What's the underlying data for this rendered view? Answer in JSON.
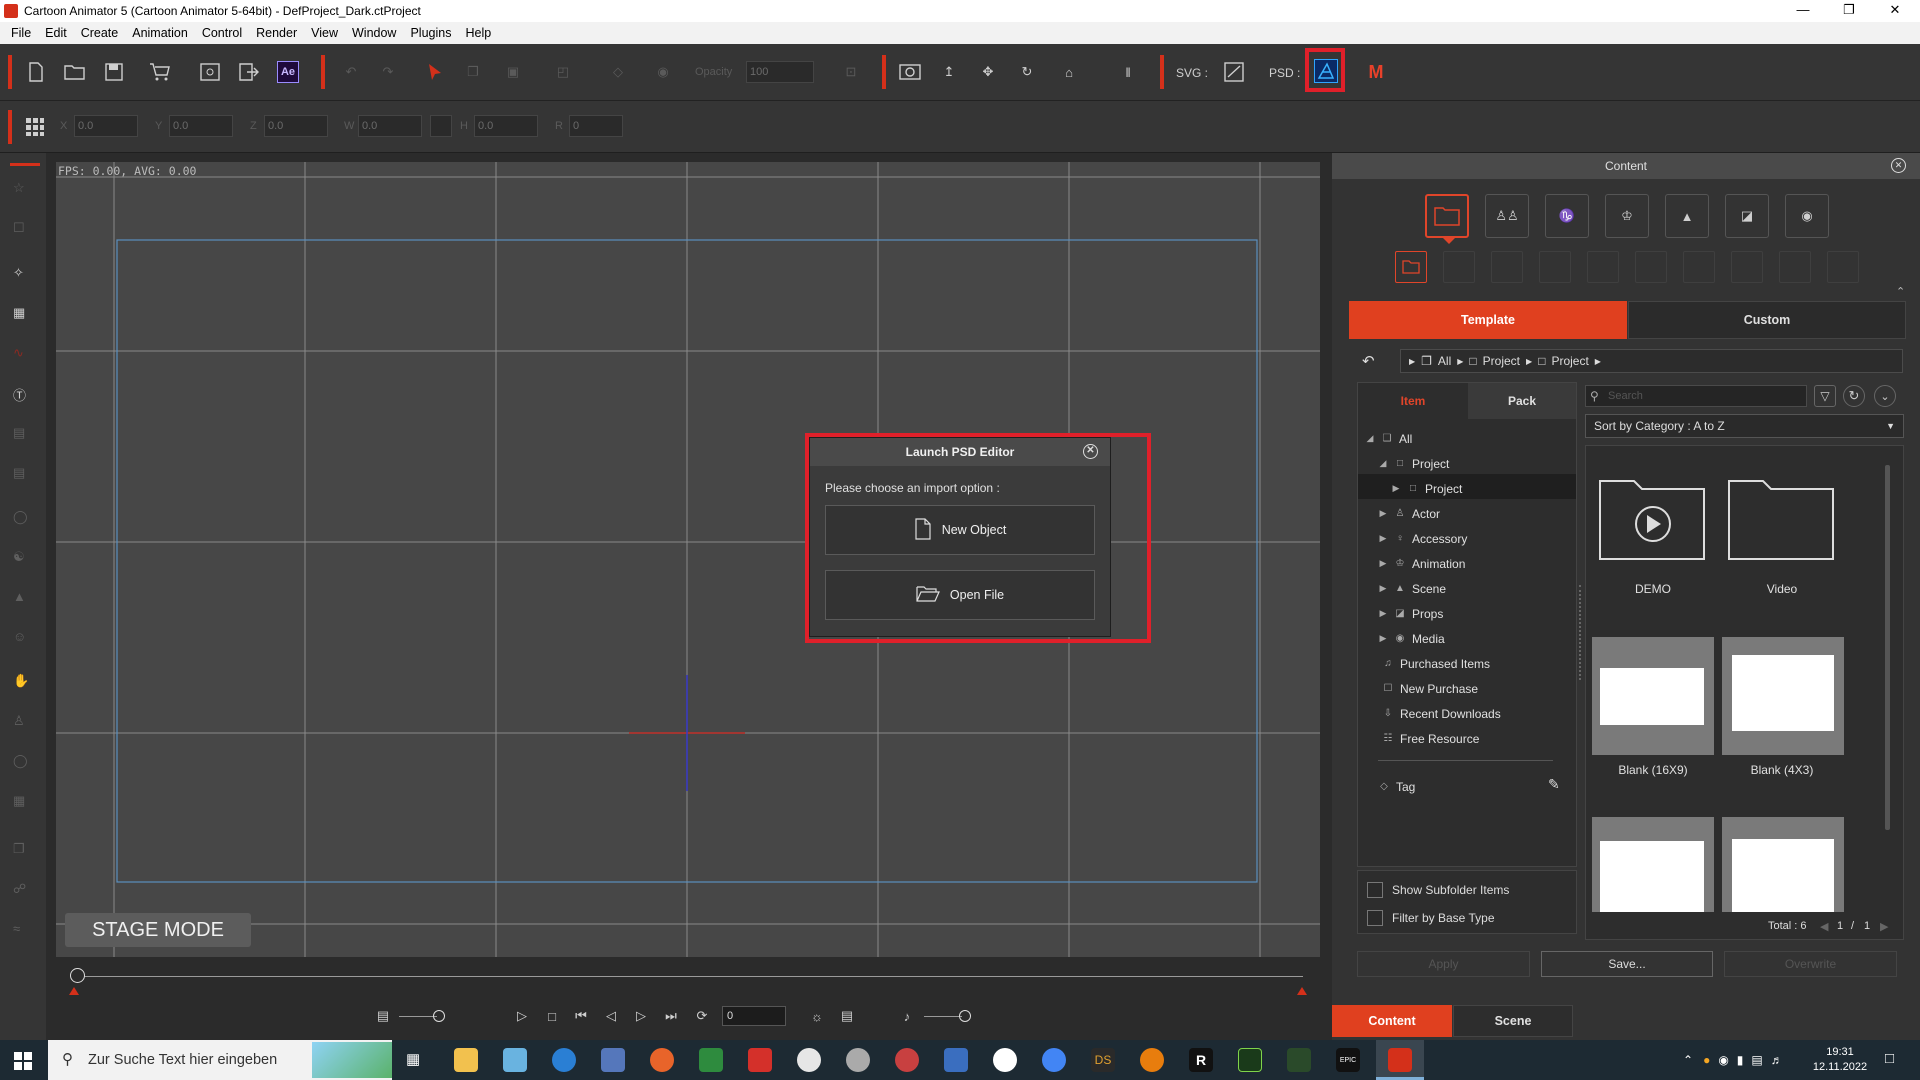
{
  "window": {
    "title": "Cartoon Animator 5  (Cartoon Animator 5-64bit) - DefProject_Dark.ctProject"
  },
  "menu": [
    "File",
    "Edit",
    "Create",
    "Animation",
    "Control",
    "Render",
    "View",
    "Window",
    "Plugins",
    "Help"
  ],
  "toolbar": {
    "ae_label": "Ae",
    "opacity_label": "Opacity",
    "opacity_value": "100",
    "svg_label": "SVG :",
    "psd_label": "PSD :"
  },
  "transform": {
    "labels": [
      "X",
      "Y",
      "Z",
      "W",
      "H",
      "R"
    ],
    "x": "0.0",
    "y": "0.0",
    "z": "0.0",
    "w": "0.0",
    "h": "0.0",
    "r": "0"
  },
  "stage": {
    "fps_text": "FPS: 0.00, AVG: 0.00",
    "mode_label": "STAGE MODE"
  },
  "dialog": {
    "title": "Launch PSD Editor",
    "prompt": "Please choose an import option :",
    "new_object_label": "New Object",
    "open_file_label": "Open File"
  },
  "content_panel": {
    "title": "Content",
    "tabs": {
      "template": "Template",
      "custom": "Custom"
    },
    "breadcrumb": [
      "All",
      "Project",
      "Project"
    ],
    "tree_tabs": {
      "item": "Item",
      "pack": "Pack"
    },
    "tree": [
      {
        "label": "All",
        "icon": "all-icon",
        "arrow": "◢",
        "indent": 0
      },
      {
        "label": "Project",
        "icon": "folder-icon",
        "arrow": "◢",
        "indent": 1
      },
      {
        "label": "Project",
        "icon": "folder-icon",
        "arrow": "▶",
        "indent": 2,
        "selected": true
      },
      {
        "label": "Actor",
        "icon": "actor-icon",
        "arrow": "▶",
        "indent": 1
      },
      {
        "label": "Accessory",
        "icon": "accessory-icon",
        "arrow": "▶",
        "indent": 1
      },
      {
        "label": "Animation",
        "icon": "animation-icon",
        "arrow": "▶",
        "indent": 1
      },
      {
        "label": "Scene",
        "icon": "scene-icon",
        "arrow": "▶",
        "indent": 1
      },
      {
        "label": "Props",
        "icon": "props-icon",
        "arrow": "▶",
        "indent": 1
      },
      {
        "label": "Media",
        "icon": "media-icon",
        "arrow": "▶",
        "indent": 1
      },
      {
        "label": "Purchased Items",
        "icon": "purchased-icon",
        "arrow": "",
        "indent": 0
      },
      {
        "label": "New Purchase",
        "icon": "cart-icon",
        "arrow": "",
        "indent": 0
      },
      {
        "label": "Recent Downloads",
        "icon": "download-icon",
        "arrow": "",
        "indent": 0
      },
      {
        "label": "Free Resource",
        "icon": "gift-icon",
        "arrow": "",
        "indent": 0
      }
    ],
    "tag_label": "Tag",
    "search_placeholder": "Search",
    "sort_label": "Sort by Category : A to Z",
    "items": [
      {
        "label": "DEMO",
        "kind": "folder-play"
      },
      {
        "label": "Video",
        "kind": "folder"
      },
      {
        "label": "Blank (16X9)",
        "kind": "blank-wide"
      },
      {
        "label": "Blank (4X3)",
        "kind": "blank-43"
      },
      {
        "label": "",
        "kind": "blank-wide"
      },
      {
        "label": "",
        "kind": "blank-43"
      }
    ],
    "show_subfolder_label": "Show Subfolder Items",
    "filter_base_label": "Filter by Base Type",
    "total_label": "Total : 6",
    "page_current": "1",
    "page_sep": "/",
    "page_total": "1",
    "apply_label": "Apply",
    "save_label": "Save...",
    "overwrite_label": "Overwrite",
    "bottom_tabs": {
      "content": "Content",
      "scene": "Scene"
    }
  },
  "timeline": {
    "frame_value": "0"
  },
  "taskbar": {
    "search_placeholder": "Zur Suche Text hier eingeben",
    "time": "19:31",
    "date": "12.11.2022"
  },
  "colors": {
    "accent": "#e0452a",
    "highlight_red": "#e0202a"
  }
}
